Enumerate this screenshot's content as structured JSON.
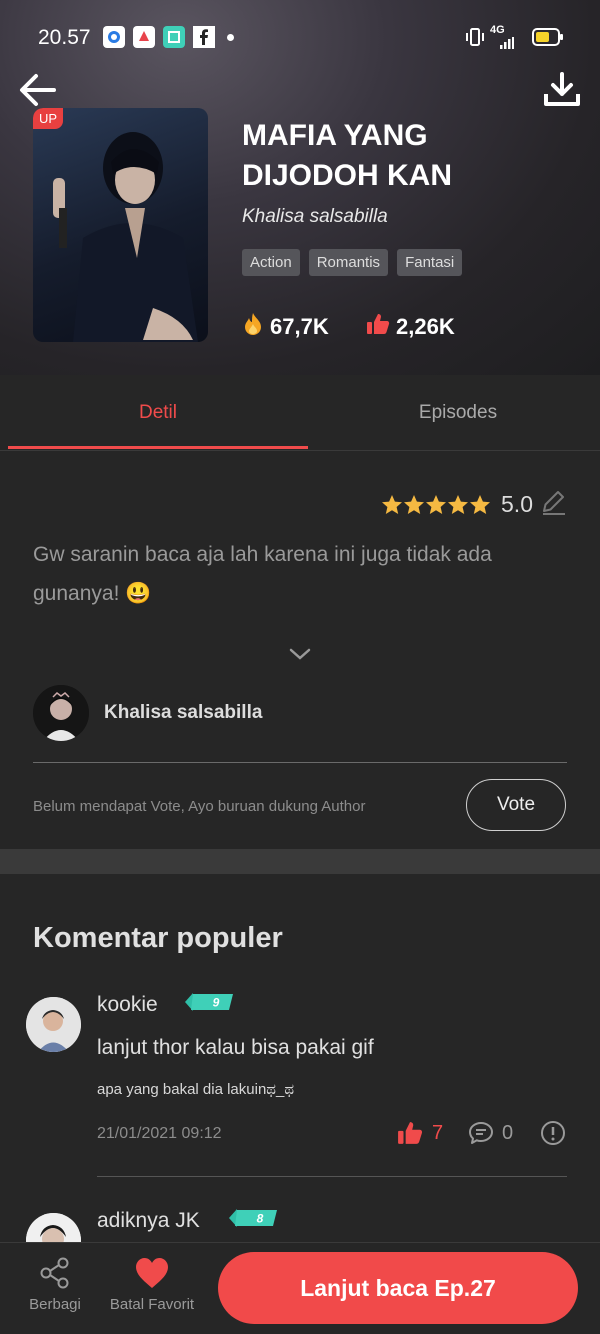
{
  "status_bar": {
    "time": "20.57",
    "network": "4G"
  },
  "novel": {
    "badge": "UP",
    "title": "MAFIA YANG DIJODOH KAN",
    "author": "Khalisa salsabilla",
    "tags": [
      "Action",
      "Romantis",
      "Fantasi"
    ],
    "views": "67,7K",
    "likes": "2,26K"
  },
  "tabs": [
    {
      "label": "Detil",
      "active": true
    },
    {
      "label": "Episodes",
      "active": false
    }
  ],
  "detail": {
    "rating": "5.0",
    "stars": 5,
    "description": "Gw saranin baca aja lah karena ini juga tidak ada gunanya! 😃",
    "author_name": "Khalisa salsabilla",
    "vote_note": "Belum mendapat Vote, Ayo buruan dukung Author",
    "vote_label": "Vote"
  },
  "comments": {
    "heading": "Komentar populer",
    "items": [
      {
        "name": "kookie",
        "level": "9",
        "text": "lanjut thor kalau bisa pakai gif",
        "sub_text": "apa yang bakal dia lakuinಥ_ಥ",
        "date": "21/01/2021 09:12",
        "likes": "7",
        "replies": "0"
      },
      {
        "name": "adiknya JK",
        "level": "8"
      }
    ]
  },
  "bottom_bar": {
    "share_label": "Berbagi",
    "unfavorite_label": "Batal Favorit",
    "cta_label": "Lanjut baca Ep.27"
  },
  "colors": {
    "accent": "#f04b4b",
    "background": "#262626",
    "star": "#f5b942",
    "badge": "#3fd0b8"
  }
}
